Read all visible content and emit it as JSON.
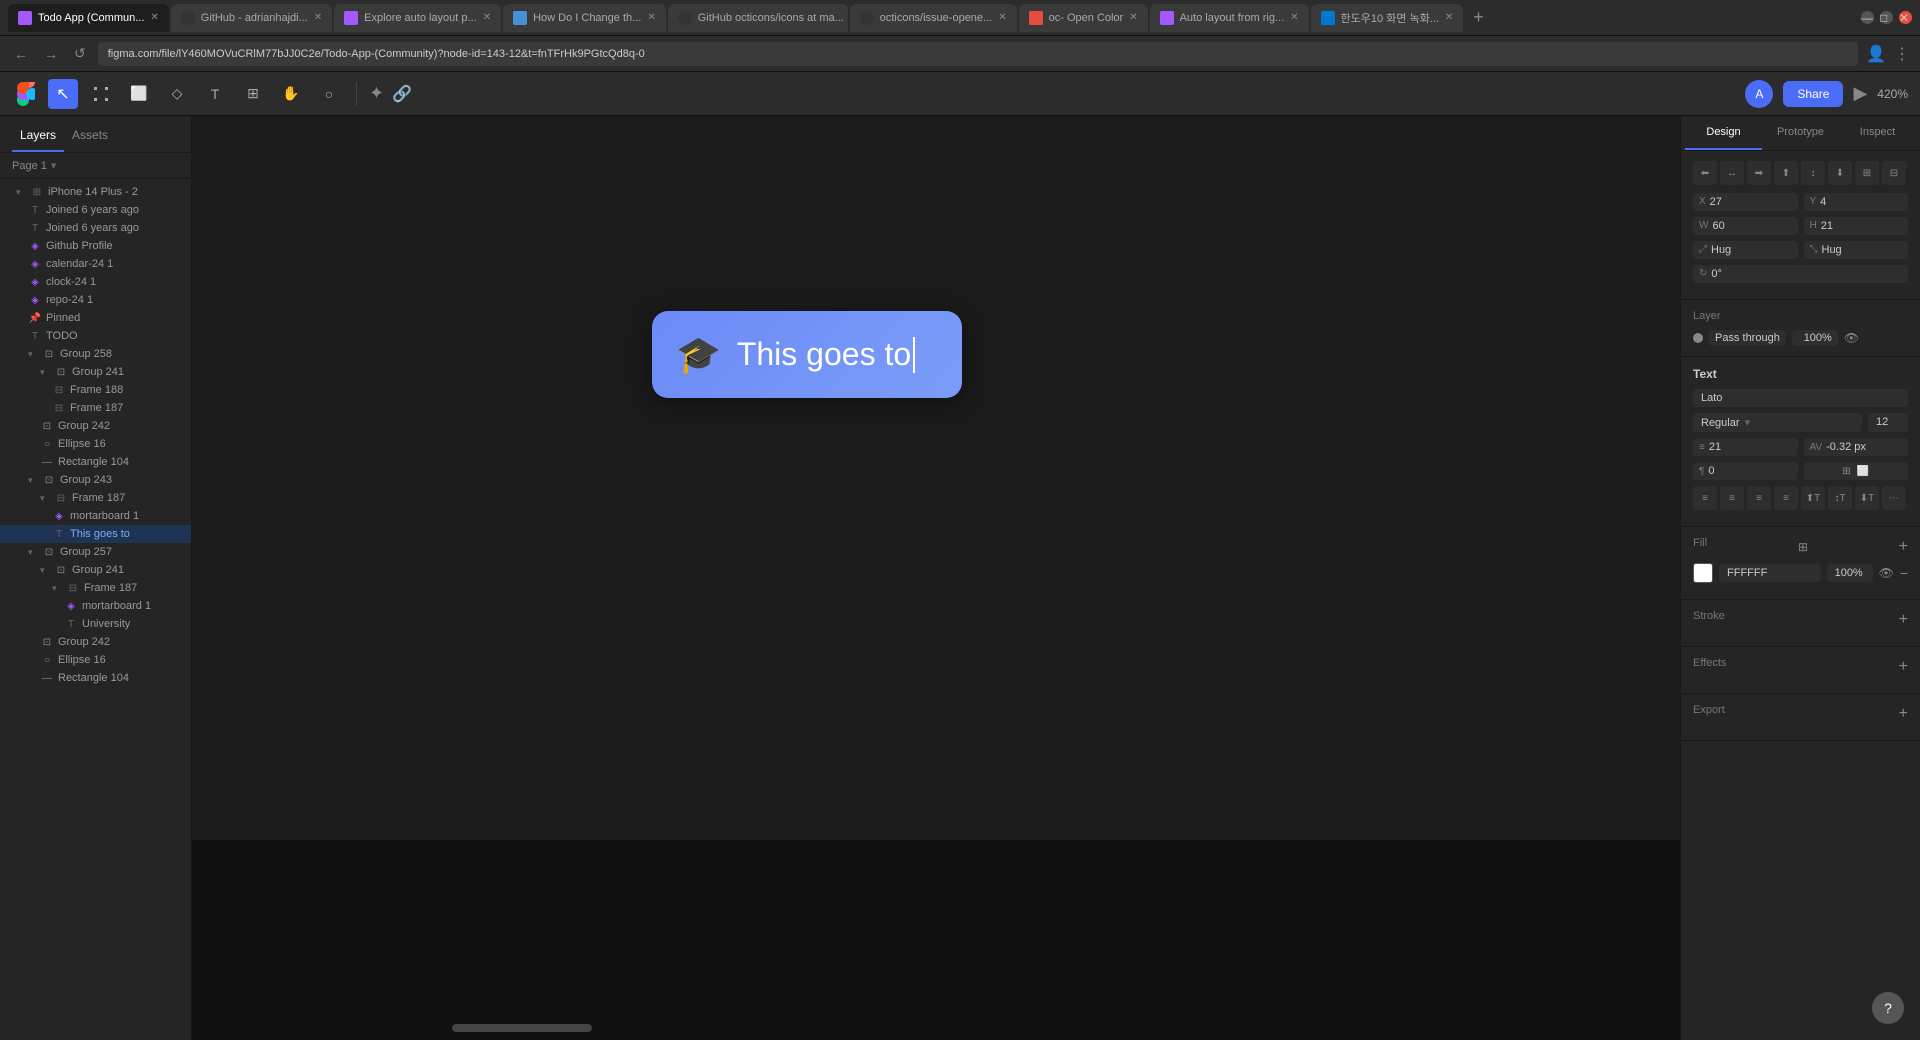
{
  "browser": {
    "tabs": [
      {
        "label": "Todo App (Commun...",
        "active": true,
        "favicon": "figma"
      },
      {
        "label": "GitHub - adrianhajdi...",
        "active": false,
        "favicon": "github"
      },
      {
        "label": "Explore auto layout p...",
        "active": false,
        "favicon": "figma"
      },
      {
        "label": "How Do I Change th...",
        "active": false,
        "favicon": "doc"
      },
      {
        "label": "GitHub octicons/icons at ma...",
        "active": false,
        "favicon": "github"
      },
      {
        "label": "octicons/issue-opene...",
        "active": false,
        "favicon": "github"
      },
      {
        "label": "oc- Open Color",
        "active": false,
        "favicon": "doc"
      },
      {
        "label": "Auto layout from rig...",
        "active": false,
        "favicon": "figma"
      },
      {
        "label": "한도우10 화면 녹화...",
        "active": false,
        "favicon": "win"
      }
    ],
    "url": "figma.com/file/lY460MOVuCRlM77bJJ0C2e/Todo-App-(Community)?node-id=143-12&t=fnTFrHk9PGtcQd8q-0"
  },
  "figma": {
    "toolbar": {
      "tools": [
        "☰",
        "↖",
        "⬜",
        "◇",
        "T",
        "⊞",
        "✋",
        "○"
      ],
      "active_tool": 1,
      "share_label": "Share",
      "zoom": "420%"
    },
    "left_panel": {
      "tabs": [
        "Layers",
        "Assets"
      ],
      "active_tab": "Layers",
      "page": "Page 1",
      "layers": [
        {
          "id": "iphone14",
          "label": "iPhone 14 Plus - 2",
          "indent": 0,
          "icon": "frame",
          "expand": true,
          "selected": false
        },
        {
          "id": "joined1",
          "label": "Joined 6 years ago",
          "indent": 1,
          "icon": "text",
          "expand": false,
          "selected": false
        },
        {
          "id": "joined2",
          "label": "Joined 6 years ago",
          "indent": 1,
          "icon": "text",
          "expand": false,
          "selected": false
        },
        {
          "id": "github",
          "label": "Github Profile",
          "indent": 1,
          "icon": "component",
          "expand": false,
          "selected": false
        },
        {
          "id": "calendar",
          "label": "calendar-24 1",
          "indent": 1,
          "icon": "component",
          "expand": false,
          "selected": false
        },
        {
          "id": "clock",
          "label": "clock-24 1",
          "indent": 1,
          "icon": "component",
          "expand": false,
          "selected": false
        },
        {
          "id": "repo",
          "label": "repo-24 1",
          "indent": 1,
          "icon": "component",
          "expand": false,
          "selected": false
        },
        {
          "id": "pinned",
          "label": "Pinned",
          "indent": 1,
          "icon": "text",
          "expand": false,
          "selected": false
        },
        {
          "id": "todo",
          "label": "TODO",
          "indent": 1,
          "icon": "text",
          "expand": false,
          "selected": false
        },
        {
          "id": "group258",
          "label": "Group 258",
          "indent": 1,
          "icon": "group",
          "expand": true,
          "selected": false
        },
        {
          "id": "group241a",
          "label": "Group 241",
          "indent": 2,
          "icon": "group",
          "expand": true,
          "selected": false
        },
        {
          "id": "frame188",
          "label": "Frame 188",
          "indent": 3,
          "icon": "frame",
          "expand": false,
          "selected": false
        },
        {
          "id": "frame187a",
          "label": "Frame 187",
          "indent": 3,
          "icon": "frame",
          "expand": false,
          "selected": false
        },
        {
          "id": "group242a",
          "label": "Group 242",
          "indent": 2,
          "icon": "group",
          "expand": false,
          "selected": false
        },
        {
          "id": "ellipse16a",
          "label": "Ellipse 16",
          "indent": 2,
          "icon": "ellipse",
          "expand": false,
          "selected": false
        },
        {
          "id": "rect104a",
          "label": "Rectangle 104",
          "indent": 2,
          "icon": "rect",
          "expand": false,
          "selected": false
        },
        {
          "id": "group243",
          "label": "Group 243",
          "indent": 1,
          "icon": "group",
          "expand": true,
          "selected": false
        },
        {
          "id": "frame187b",
          "label": "Frame 187",
          "indent": 2,
          "icon": "frame",
          "expand": true,
          "selected": false
        },
        {
          "id": "mortarboard1",
          "label": "mortarboard 1",
          "indent": 3,
          "icon": "component",
          "expand": false,
          "selected": false
        },
        {
          "id": "thisgoes",
          "label": "This goes to",
          "indent": 3,
          "icon": "text",
          "expand": false,
          "selected": true
        },
        {
          "id": "group257",
          "label": "Group 257",
          "indent": 1,
          "icon": "group",
          "expand": true,
          "selected": false
        },
        {
          "id": "group241b",
          "label": "Group 241",
          "indent": 2,
          "icon": "group",
          "expand": true,
          "selected": false
        },
        {
          "id": "frame187c",
          "label": "Frame 187",
          "indent": 3,
          "icon": "frame",
          "expand": true,
          "selected": false
        },
        {
          "id": "mortarboard1b",
          "label": "mortarboard 1",
          "indent": 4,
          "icon": "component",
          "expand": false,
          "selected": false
        },
        {
          "id": "university",
          "label": "University",
          "indent": 4,
          "icon": "text",
          "expand": false,
          "selected": false
        },
        {
          "id": "group242b",
          "label": "Group 242",
          "indent": 2,
          "icon": "group",
          "expand": false,
          "selected": false
        },
        {
          "id": "ellipse16b",
          "label": "Ellipse 16",
          "indent": 2,
          "icon": "ellipse",
          "expand": false,
          "selected": false
        },
        {
          "id": "rect104b",
          "label": "Rectangle 104",
          "indent": 2,
          "icon": "rect",
          "expand": false,
          "selected": false
        }
      ]
    },
    "canvas": {
      "element": {
        "text": "This goes to",
        "icon": "🎓"
      }
    },
    "right_panel": {
      "tabs": [
        "Design",
        "Prototype",
        "Inspect"
      ],
      "active_tab": "Design",
      "alignment": {
        "buttons": [
          "⬛",
          "⬛",
          "⬛",
          "⬛",
          "⬛",
          "⬛",
          "⬛",
          "⬛"
        ]
      },
      "position": {
        "x_label": "X",
        "x_value": "27",
        "y_label": "Y",
        "y_value": "4",
        "w_label": "W",
        "w_value": "60",
        "h_label": "H",
        "h_value": "21",
        "hug_h": "Hug",
        "hug_w": "Hug",
        "rotation": "0°"
      },
      "layer": {
        "title": "Layer",
        "mode": "Pass through",
        "opacity": "100%"
      },
      "text": {
        "title": "Text",
        "font": "Lato",
        "style": "Regular",
        "size": "12",
        "line_height": "21",
        "letter_spacing": "-0.32 px",
        "paragraph_spacing": "0",
        "align_buttons": [
          "≡",
          "≡",
          "≡",
          "T↑",
          "T↕",
          "T↓",
          "⋯"
        ]
      },
      "fill": {
        "title": "Fill",
        "color": "#FFFFFF",
        "hex": "FFFFFF",
        "opacity": "100%"
      },
      "stroke": {
        "title": "Stroke"
      },
      "effects": {
        "title": "Effects"
      },
      "export": {
        "title": "Export"
      }
    }
  }
}
